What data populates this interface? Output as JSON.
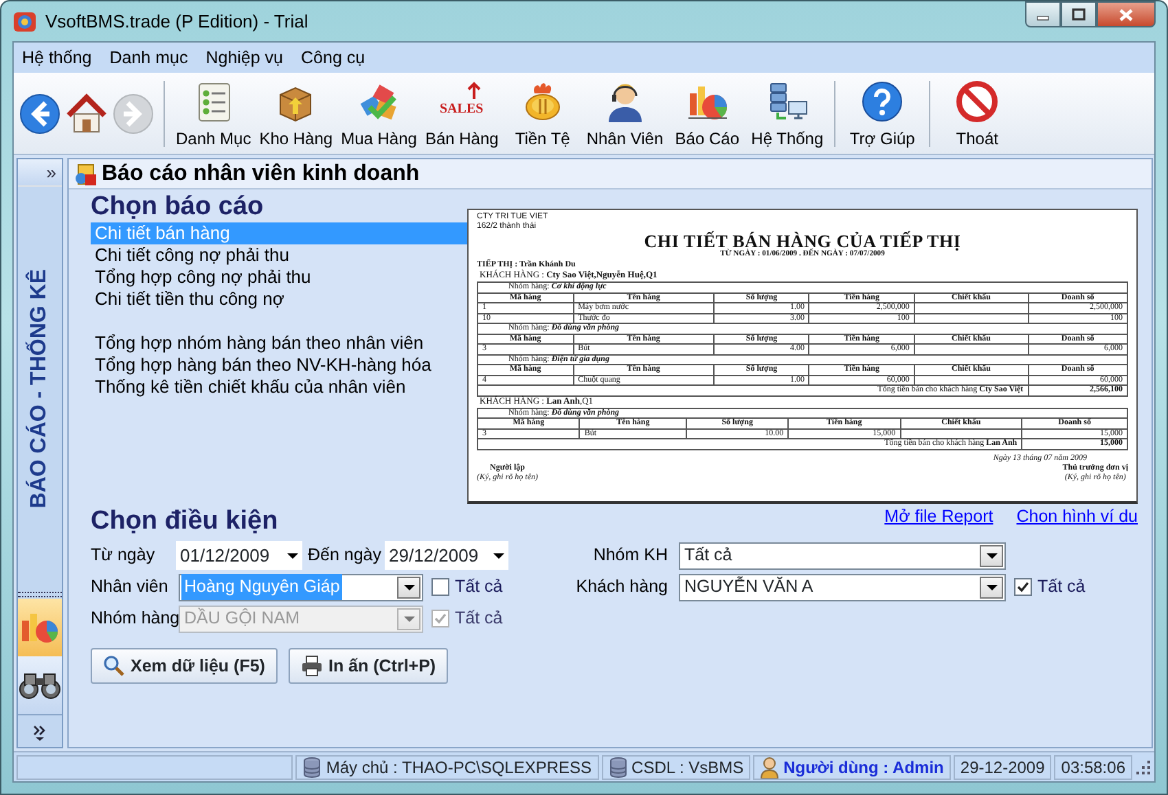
{
  "window": {
    "title": "VsoftBMS.trade (P Edition) - Trial"
  },
  "menu": [
    "Hệ thống",
    "Danh mục",
    "Nghiệp vụ",
    "Công cụ"
  ],
  "toolbar": {
    "nav": [
      {
        "disabled": false
      },
      {
        "disabled": false
      },
      {
        "disabled": true
      }
    ],
    "groups": [
      [
        {
          "label": "Danh Mục"
        },
        {
          "label": "Kho Hàng"
        },
        {
          "label": "Mua Hàng"
        },
        {
          "label": "Bán Hàng",
          "icon_text": "SALES"
        },
        {
          "label": "Tiền Tệ"
        },
        {
          "label": "Nhân Viên"
        },
        {
          "label": "Báo Cáo"
        },
        {
          "label": "Hệ Thống"
        }
      ],
      [
        {
          "label": "Trợ Giúp"
        }
      ],
      [
        {
          "label": "Thoát"
        }
      ]
    ]
  },
  "sidebar": {
    "expand": "»",
    "title": "BÁO CÁO - THỐNG KÊ",
    "modules": [
      {
        "selected": true
      },
      {
        "selected": false
      }
    ]
  },
  "panel": {
    "title": "Báo cáo nhân viên kinh doanh",
    "reports_heading": "Chọn báo cáo",
    "report_groups": [
      [
        {
          "label": "Chi tiết bán hàng",
          "selected": true
        },
        {
          "label": "Chi tiết công nợ phải thu",
          "selected": false
        },
        {
          "label": "Tổng hợp công nợ phải thu",
          "selected": false
        },
        {
          "label": "Chi tiết tiền thu công nợ",
          "selected": false
        }
      ],
      [
        {
          "label": "Tổng hợp nhóm hàng bán theo nhân viên",
          "selected": false
        },
        {
          "label": "Tổng hợp hàng bán theo NV-KH-hàng hóa",
          "selected": false
        },
        {
          "label": "Thống kê tiền chiết khấu của nhân viên",
          "selected": false
        }
      ]
    ],
    "report_preview": {
      "company": "CTY TRI TUE VIET",
      "address": "162/2 thành thái",
      "title": "CHI TIẾT BÁN HÀNG CỦA TIẾP THỊ",
      "subtitle": "TỪ NGÀY : 01/06/2009  .  ĐẾN NGÀY : 07/07/2009",
      "salesperson": "TIẾP THỊ : Trần Khánh Du",
      "customers": [
        {
          "heading": "KHÁCH HÀNG : **Cty Sao Việt,Nguyễn Huệ,Q1**",
          "groups": [
            {
              "heading": "Nhóm hàng: **Cơ khí động lực**",
              "columns": [
                "Mã hàng",
                "Tên hàng",
                "Số lượng",
                "Tiền hàng",
                "Chiết khấu",
                "Doanh số"
              ],
              "rows": [
                {
                  "code": "1",
                  "item": "Máy bơm nước",
                  "qty": "1.00",
                  "amount": "2,500,000",
                  "sales": "2,500,000"
                },
                {
                  "code": "10",
                  "item": "Thước đo",
                  "qty": "3.00",
                  "amount": "100",
                  "sales": "100"
                }
              ]
            },
            {
              "heading": "Nhóm hàng: **Đồ dùng văn phòng**",
              "columns": [
                "Mã hàng",
                "Tên hàng",
                "Số lượng",
                "Tiền hàng",
                "Chiết khấu",
                "Doanh số"
              ],
              "rows": [
                {
                  "code": "3",
                  "item": "Bút",
                  "qty": "4.00",
                  "amount": "6,000",
                  "sales": "6,000"
                }
              ]
            },
            {
              "heading": "Nhóm hàng: **Điện tử gia dụng**",
              "columns": [
                "Mã hàng",
                "Tên hàng",
                "Số lượng",
                "Tiền hàng",
                "Chiết khấu",
                "Doanh số"
              ],
              "rows": [
                {
                  "code": "4",
                  "item": "Chuột quang",
                  "qty": "1.00",
                  "amount": "60,000",
                  "sales": "60,000"
                }
              ]
            }
          ],
          "total_label": "Tổng tiền bán cho khách hàng **Cty Sao Việt**",
          "total": "2,566,100"
        },
        {
          "heading": "KHÁCH HÀNG : **Lan Anh**,Q1",
          "groups": [
            {
              "heading": "Nhóm hàng: **Đồ dùng văn phòng**",
              "columns": [
                "Mã hàng",
                "Tên hàng",
                "Số lượng",
                "Tiền hàng",
                "Chiết khấu",
                "Doanh số"
              ],
              "rows": [
                {
                  "code": "3",
                  "item": "Bút",
                  "qty": "10.00",
                  "amount": "15,000",
                  "sales": "15,000"
                }
              ]
            }
          ],
          "total_label": "Tổng tiền bán cho khách hàng **Lan Anh**",
          "total": "15,000"
        }
      ],
      "date_line": "Ngày 13 tháng 07 năm 2009",
      "signatures": [
        {
          "title": "Người lập",
          "note": "(Ký, ghi rõ họ tên)"
        },
        {
          "title": "Thủ trưởng đơn vị",
          "note": "(Ký, ghi rõ họ tên)"
        }
      ]
    },
    "links": [
      "Mở file Report",
      "Chon hình ví du"
    ],
    "conditions_heading": "Chọn điều kiện",
    "from_date": {
      "label": "Từ ngày",
      "value": "01/12/2009"
    },
    "to_date": {
      "label": "Đến ngày",
      "value": "29/12/2009"
    },
    "customer_group": {
      "label": "Nhóm KH",
      "value": "Tất cả"
    },
    "employee": {
      "label": "Nhân viên",
      "value": "Hoàng Nguyên Giáp",
      "highlighted": true,
      "all": {
        "label": "Tất cả",
        "checked": false
      }
    },
    "customer": {
      "label": "Khách hàng",
      "value": "NGUYỄN VĂN A",
      "highlighted": false,
      "all": {
        "label": "Tất cả",
        "checked": true
      }
    },
    "product_group": {
      "label": "Nhóm hàng",
      "value": "DẦU GỘI NAM",
      "disabled": true,
      "all": {
        "label": "Tất cả",
        "checked": true,
        "disabled": true
      }
    },
    "buttons": [
      {
        "label": "Xem dữ liệu (F5)"
      },
      {
        "label": "In ấn (Ctrl+P)"
      }
    ]
  },
  "status_bar": {
    "server": "Máy chủ : THAO-PC\\SQLEXPRESS",
    "database": "CSDL : VsBMS",
    "user": "Người dùng : Admin",
    "date": "29-12-2009",
    "time": "03:58:06"
  }
}
